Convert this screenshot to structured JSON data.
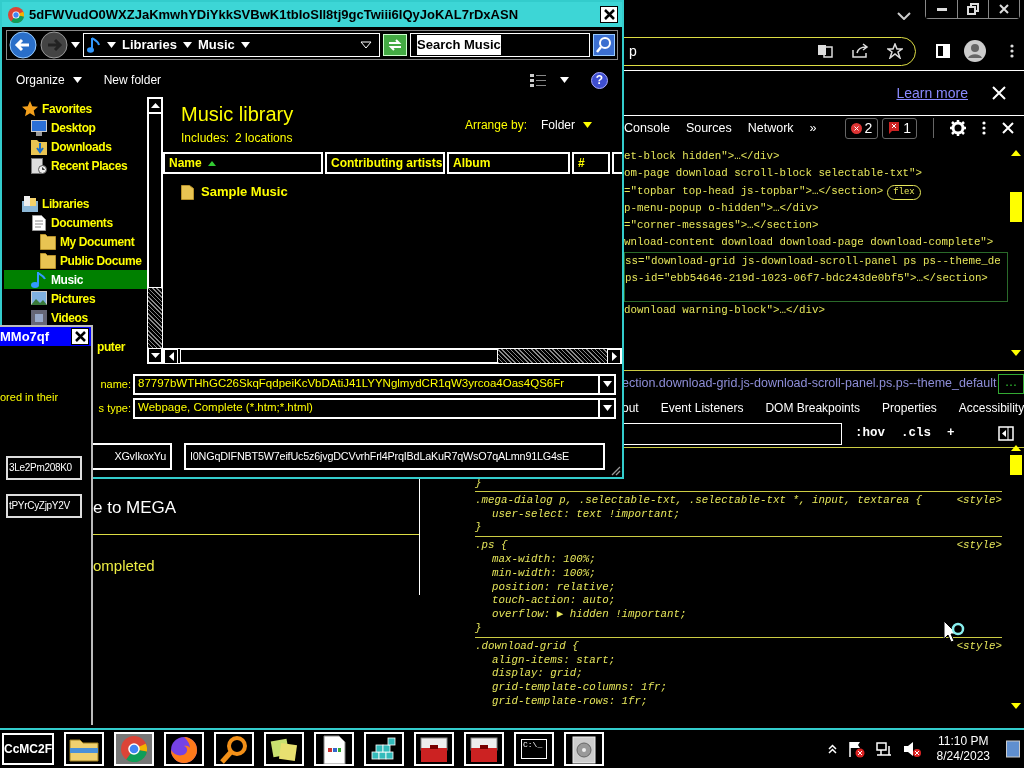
{
  "save_dialog": {
    "title": "5dFWVudO0WXZJaKmwhYDiYkkSVBwK1tbIoSIl8tj9gcTwiii6IQyJoKAL7rDxASN",
    "path": [
      "Libraries",
      "Music"
    ],
    "search": {
      "value": "Search Music",
      "text_selected": true
    },
    "toolbar": [
      {
        "label": "Organize",
        "menu": true
      },
      {
        "label": "New folder",
        "menu": false
      }
    ],
    "help": "?",
    "nav": [
      {
        "label": "Favorites",
        "kind": "favorites",
        "selected": false,
        "children": [
          {
            "label": "Desktop",
            "kind": "desktop",
            "selected": false
          },
          {
            "label": "Downloads",
            "kind": "downloads",
            "selected": false
          },
          {
            "label": "Recent Places",
            "kind": "recent",
            "selected": false
          }
        ]
      },
      {
        "label": "Libraries",
        "kind": "libraries",
        "selected": false,
        "children": [
          {
            "label": "Documents",
            "kind": "document",
            "selected": false,
            "children": [
              {
                "label": "My Document",
                "kind": "folder",
                "selected": false
              },
              {
                "label": "Public Docume",
                "kind": "folder",
                "selected": false
              }
            ]
          },
          {
            "label": "Music",
            "kind": "music",
            "selected": true
          },
          {
            "label": "Pictures",
            "kind": "pictures",
            "selected": false
          },
          {
            "label": "Videos",
            "kind": "videos",
            "selected": false
          }
        ]
      },
      {
        "label": "puter",
        "kind": "cut",
        "selected": false
      }
    ],
    "library": {
      "title": "Music library",
      "includes_label": "Includes:",
      "includes_link": "2 locations",
      "arrange_label": "Arrange by:",
      "arrange_value": "Folder"
    },
    "columns": [
      {
        "label": "Name",
        "sorted": true
      },
      {
        "label": "Contributing artists",
        "sorted": false
      },
      {
        "label": "Album",
        "sorted": false
      },
      {
        "label": "#",
        "sorted": false
      }
    ],
    "items": [
      {
        "label": "Sample Music"
      }
    ],
    "file_name": {
      "label": "name:",
      "value": "87797bWTHhGC26SkqFqdpeiKcVbDAtiJ41LYYNglmydCR1qW3yrcoa4Oas4QS6Fr"
    },
    "file_type": {
      "label": "s type:",
      "value": "Webpage, Complete (*.htm;*.html)"
    },
    "fields": [
      "XGvIkoxYu",
      "I0NGqDIFNBT5W7eifUc5z6jvgDCVvrhFrl4PrqIBdLaKuR7qWsO7qALmn91LG4sE"
    ]
  },
  "small_dialog": {
    "title": "MMo7qf",
    "text": "ored in their",
    "fields": [
      "3Le2Pm208K0",
      "tPYrCyZjpY2V"
    ]
  },
  "browser": {
    "address_text": "p",
    "infobar": {
      "link": "Learn more"
    },
    "devtools": {
      "tabs": [
        "Console",
        "Sources",
        "Network"
      ],
      "more_tabs": "»",
      "error_count": "2",
      "issue_count": "1",
      "dom_lines": [
        {
          "text": "et-block hidden\">…</div>",
          "selected": false
        },
        {
          "text": "om-page download scroll-block selectable-txt\">",
          "selected": false
        },
        {
          "text": "=\"topbar top-head js-topbar\">…</section>",
          "selected": false,
          "badge": "flex"
        },
        {
          "text": "p-menu-popup o-hidden\">…</div>",
          "selected": false
        },
        {
          "text": "=\"corner-messages\">…</section>",
          "selected": false
        },
        {
          "text": "wnload-content download download-page download-complete\">",
          "selected": false
        },
        {
          "text": "ss=\"download-grid js-download-scroll-panel ps ps--theme_de",
          "selected": true
        },
        {
          "text": "ps-id=\"ebb54646-219d-1023-06f7-bdc243de0bf5\">…</section>",
          "selected": true
        },
        {
          "text": "download warning-block\">…</div>",
          "selected": false
        }
      ],
      "breadcrumb": "ection.download-grid.js-download-scroll-panel.ps.ps--theme_default",
      "breadcrumb_more": "…",
      "sidebar_tabs": [
        "out",
        "Event Listeners",
        "DOM Breakpoints",
        "Properties",
        "Accessibility"
      ],
      "filter_buttons": [
        ":hov",
        ".cls",
        "+"
      ],
      "styles_top": "}",
      "rules": [
        {
          "selector": ".mega-dialog p, .selectable-txt, .selectable-txt *, input, textarea {",
          "source": "<style>",
          "declarations": [
            "user-select: text !important;"
          ],
          "close": "}"
        },
        {
          "selector": ".ps {",
          "source": "<style>",
          "declarations": [
            "max-width: 100%;",
            "min-width: 100%;",
            "position: relative;",
            "touch-action: auto;",
            "overflow: ▶ hidden !important;"
          ],
          "close": "}"
        },
        {
          "selector": ".download-grid {",
          "source": "<style>",
          "declarations": [
            "align-items: start;",
            "display: grid;",
            "grid-template-columns: 1fr;",
            "grid-template-rows: 1fr;"
          ]
        }
      ]
    }
  },
  "page": {
    "heading": "e to MEGA",
    "status": "ompleted"
  },
  "taskbar": {
    "start_label": "CcMC2F",
    "items": [
      {
        "kind": "folder",
        "selected": false
      },
      {
        "kind": "chrome",
        "selected": true
      },
      {
        "kind": "firefox",
        "selected": false
      },
      {
        "kind": "search",
        "selected": false
      },
      {
        "kind": "notes",
        "selected": false
      },
      {
        "kind": "document",
        "selected": false
      },
      {
        "kind": "cubes",
        "selected": false
      },
      {
        "kind": "toolbox",
        "selected": false
      },
      {
        "kind": "toolbox",
        "selected": false
      },
      {
        "kind": "terminal",
        "selected": false,
        "label": "C:\\_"
      },
      {
        "kind": "disk",
        "selected": false
      }
    ],
    "time": "11:10 PM",
    "date": "8/24/2023"
  }
}
